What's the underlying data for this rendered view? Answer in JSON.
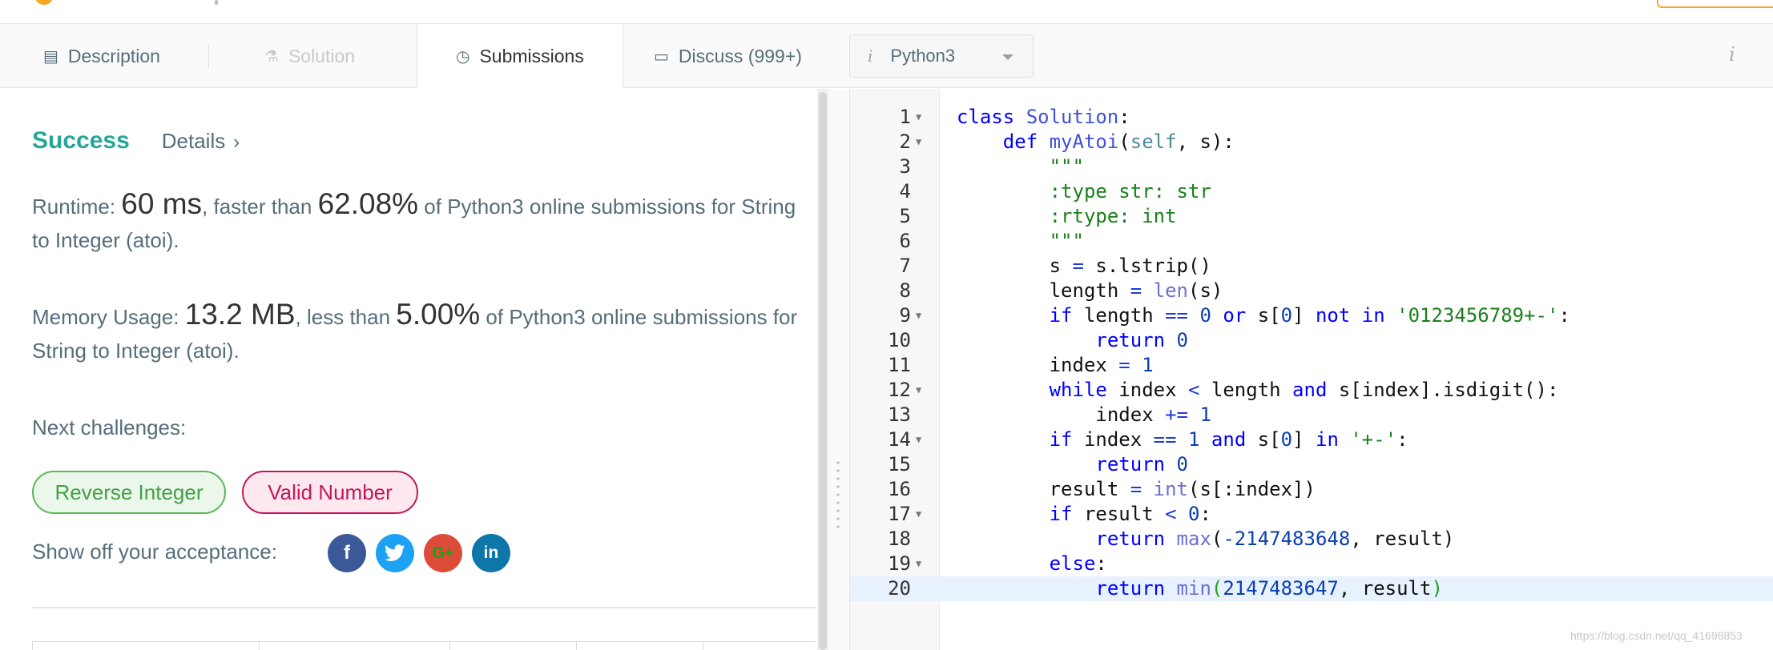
{
  "tabs": [
    {
      "label": "Description",
      "icon": "description-icon",
      "state": "normal"
    },
    {
      "label": "Solution",
      "icon": "flask-icon",
      "state": "disabled"
    },
    {
      "label": "Submissions",
      "icon": "clock-icon",
      "state": "active"
    },
    {
      "label": "Discuss (999+)",
      "icon": "comment-icon",
      "state": "normal"
    }
  ],
  "language": {
    "selected": "Python3",
    "info_glyph": "i"
  },
  "right_info_glyph": "i",
  "result": {
    "status": "Success",
    "details_label": "Details",
    "details_chevron": "›",
    "runtime": {
      "label": "Runtime: ",
      "value": "60 ms",
      "mid": ", faster than ",
      "percent": "62.08%",
      "tail": " of Python3 online submissions for String to Integer (atoi)."
    },
    "memory": {
      "label": "Memory Usage: ",
      "value": "13.2 MB",
      "mid": ", less than ",
      "percent": "5.00%",
      "tail": " of Python3 online submissions for String to Integer (atoi)."
    }
  },
  "next_challenges": {
    "label": "Next challenges:",
    "items": [
      {
        "label": "Reverse Integer",
        "difficulty_color": "#5cb85c"
      },
      {
        "label": "Valid Number",
        "difficulty_color": "#c2185b"
      }
    ]
  },
  "share": {
    "label": "Show off your acceptance:",
    "networks": [
      {
        "name": "facebook-icon",
        "glyph": "f",
        "color": "#3b5998"
      },
      {
        "name": "twitter-icon",
        "glyph": "t",
        "color": "#1da1f2"
      },
      {
        "name": "google-plus-icon",
        "glyph": "G+",
        "color": "#dd4b39"
      },
      {
        "name": "linkedin-icon",
        "glyph": "in",
        "color": "#0e76a8"
      }
    ]
  },
  "code": {
    "current_line": 20,
    "fold_lines": [
      1,
      2,
      9,
      12,
      14,
      17,
      19
    ],
    "lines": [
      "class Solution:",
      "    def myAtoi(self, s):",
      "        \"\"\"",
      "        :type str: str",
      "        :rtype: int",
      "        \"\"\"",
      "        s = s.lstrip()",
      "        length = len(s)",
      "        if length == 0 or s[0] not in '0123456789+-':",
      "            return 0",
      "        index = 1",
      "        while index < length and s[index].isdigit():",
      "            index += 1",
      "        if index == 1 and s[0] in '+-':",
      "            return 0",
      "        result = int(s[:index])",
      "        if result < 0:",
      "            return max(-2147483648, result)",
      "        else:",
      "            return min(2147483647, result)"
    ]
  },
  "watermark": "https://blog.csdn.net/qq_41698853"
}
